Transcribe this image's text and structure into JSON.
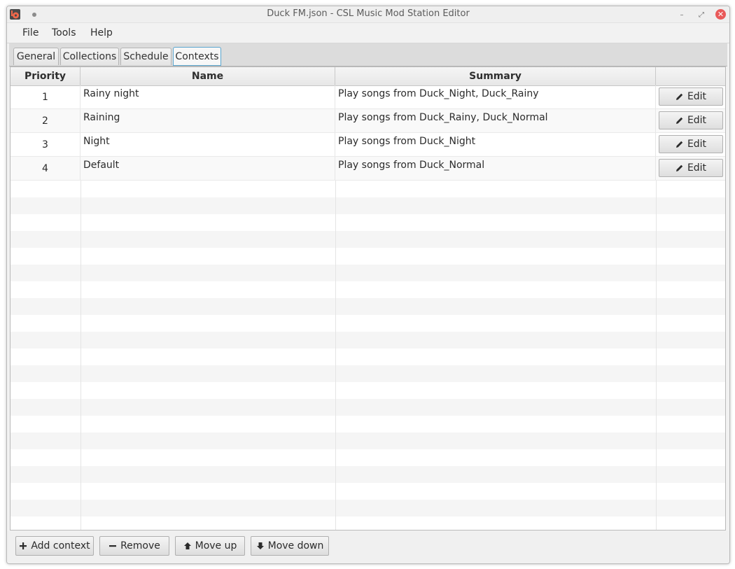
{
  "window": {
    "title": "Duck FM.json - CSL Music Mod Station Editor",
    "controls": {
      "minimize": "–",
      "maximize": "⤢",
      "close": "✕"
    }
  },
  "menu": {
    "file": "File",
    "tools": "Tools",
    "help": "Help"
  },
  "tabs": [
    {
      "label": "General",
      "active": false
    },
    {
      "label": "Collections",
      "active": false
    },
    {
      "label": "Schedule",
      "active": false
    },
    {
      "label": "Contexts",
      "active": true
    }
  ],
  "table": {
    "columns": {
      "priority": "Priority",
      "name": "Name",
      "summary": "Summary",
      "action": ""
    },
    "rows": [
      {
        "priority": "1",
        "name": "Rainy night",
        "summary": "Play songs from Duck_Night, Duck_Rainy",
        "action": "Edit"
      },
      {
        "priority": "2",
        "name": "Raining",
        "summary": "Play songs from Duck_Rainy, Duck_Normal",
        "action": "Edit"
      },
      {
        "priority": "3",
        "name": "Night",
        "summary": "Play songs from Duck_Night",
        "action": "Edit"
      },
      {
        "priority": "4",
        "name": "Default",
        "summary": "Play songs from Duck_Normal",
        "action": "Edit"
      }
    ]
  },
  "toolbar": {
    "add": "Add context",
    "remove": "Remove",
    "move_up": "Move up",
    "move_down": "Move down"
  },
  "icons": {
    "app": "radio-app-icon",
    "edit": "pencil-icon",
    "add": "plus-icon",
    "remove": "minus-icon",
    "move_up": "arrow-up-icon",
    "move_down": "arrow-down-icon"
  },
  "colors": {
    "active_tab_border": "#5aa6cf",
    "close_button": "#e95a5a"
  }
}
